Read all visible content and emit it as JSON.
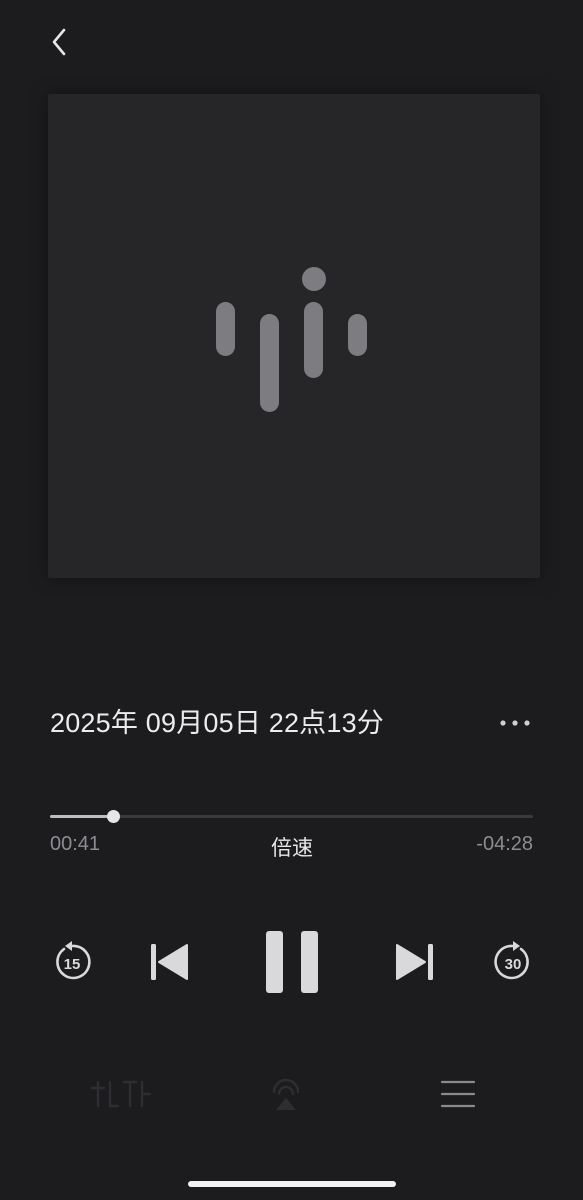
{
  "header": {
    "back_icon": "chevron-left-icon"
  },
  "artwork": {
    "logo_icon": "podcast-waveform-icon",
    "background": "#262528",
    "logo_color": "#8a898e"
  },
  "track": {
    "title": "2025年 09月05日 22点13分",
    "more_icon": "ellipsis-icon"
  },
  "progress": {
    "elapsed": "00:41",
    "remaining": "-04:28",
    "fraction": 0.13,
    "speed_label": "倍速"
  },
  "controls": {
    "skip_back_seconds": "15",
    "skip_forward_seconds": "30",
    "previous_icon": "skip-previous-icon",
    "play_pause_icon": "pause-icon",
    "next_icon": "skip-next-icon"
  },
  "bottom_bar": {
    "lyrics_icon": "lyrics-icon",
    "airplay_icon": "airplay-icon",
    "queue_icon": "queue-list-icon"
  },
  "colors": {
    "background": "#1c1b1e",
    "control": "#d9d9dc",
    "secondary_text": "#8d8c91"
  }
}
